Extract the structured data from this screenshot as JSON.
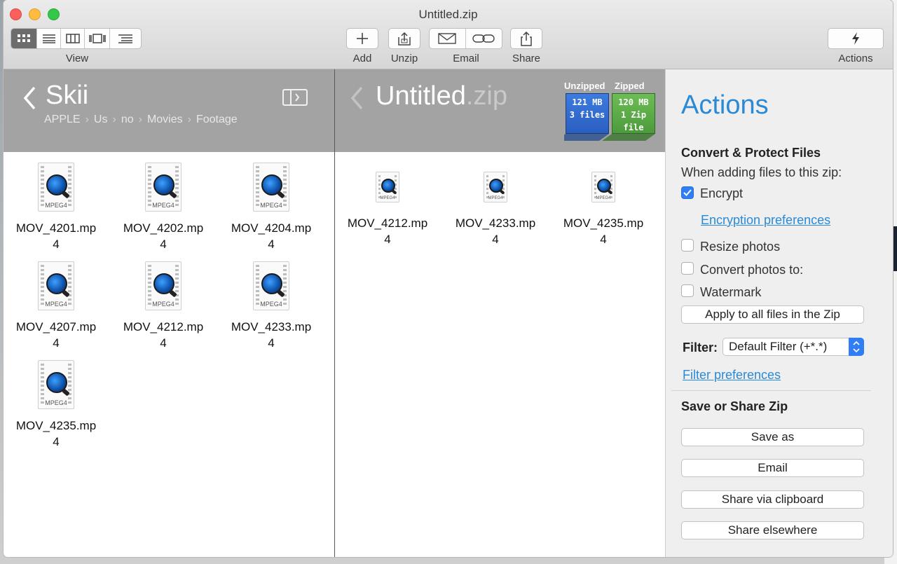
{
  "window": {
    "title": "Untitled.zip"
  },
  "toolbar": {
    "view_label": "View",
    "add_label": "Add",
    "unzip_label": "Unzip",
    "email_label": "Email",
    "share_label": "Share",
    "actions_label": "Actions"
  },
  "left": {
    "title": "Skii",
    "breadcrumbs": [
      "APPLE",
      "Us",
      "no",
      "Movies",
      "Footage"
    ],
    "files": [
      {
        "name": "MOV_4201.mp",
        "tail": "4"
      },
      {
        "name": "MOV_4202.mp",
        "tail": "4"
      },
      {
        "name": "MOV_4204.mp",
        "tail": "4"
      },
      {
        "name": "MOV_4207.mp",
        "tail": "4"
      },
      {
        "name": "MOV_4212.mp",
        "tail": "4"
      },
      {
        "name": "MOV_4233.mp",
        "tail": "4"
      },
      {
        "name": "MOV_4235.mp",
        "tail": "4"
      }
    ],
    "icon_badge": "MPEG4"
  },
  "zip": {
    "title_base": "Untitled",
    "title_ext": ".zip",
    "unzipped_label": "Unzipped",
    "zipped_label": "Zipped",
    "unzipped_size": "121 MB",
    "unzipped_count": "3 files",
    "zipped_size": "120 MB",
    "zipped_count": "1 Zip file",
    "files": [
      {
        "name": "MOV_4212.mp",
        "tail": "4"
      },
      {
        "name": "MOV_4233.mp",
        "tail": "4"
      },
      {
        "name": "MOV_4235.mp",
        "tail": "4"
      }
    ]
  },
  "actions": {
    "title": "Actions",
    "convert_heading": "Convert & Protect Files",
    "adding_text": "When adding files to this zip:",
    "encrypt_label": "Encrypt",
    "encrypt_checked": true,
    "encryption_prefs": "Encryption preferences",
    "resize_label": "Resize photos",
    "convert_label": "Convert photos to:",
    "watermark_label": "Watermark",
    "apply_button": "Apply to all files in the Zip",
    "filter_label": "Filter:",
    "filter_value": "Default Filter (+*.*)",
    "filter_prefs": "Filter preferences",
    "save_heading": "Save or Share Zip",
    "save_as": "Save as",
    "email": "Email",
    "share_clipboard": "Share via clipboard",
    "share_elsewhere": "Share elsewhere"
  },
  "colors": {
    "accent": "#2a8ad6",
    "checkbox": "#2f7ef3",
    "unzipped_box": "#2f6bd1",
    "zipped_box": "#5aa845"
  }
}
